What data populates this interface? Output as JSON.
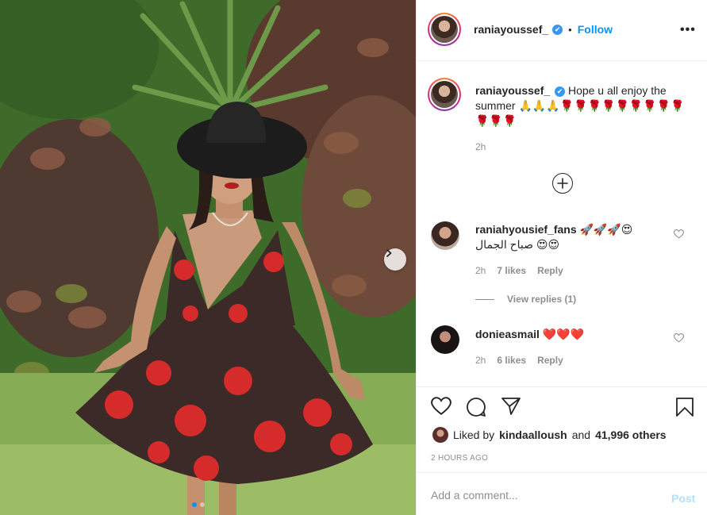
{
  "post": {
    "username": "raniayoussef_",
    "verified_icon": "✔",
    "follow_label": "Follow",
    "separator": "•",
    "more_icon": "•••"
  },
  "caption": {
    "username": "raniayoussef_",
    "text": "Hope u all enjoy the summer 🙏🙏🙏🌹🌹🌹🌹🌹🌹🌹🌹🌹🌹🌹🌹",
    "time": "2h"
  },
  "comments": [
    {
      "username": "raniahyousief_fans",
      "text": "🚀🚀🚀😍 صباح الجمال 😍😍",
      "time": "2h",
      "likes": "7 likes",
      "reply": "Reply",
      "view_replies": "View replies (1)"
    },
    {
      "username": "donieasmail",
      "text": "❤️❤️❤️",
      "time": "2h",
      "likes": "6 likes",
      "reply": "Reply"
    }
  ],
  "likes_summary": {
    "prefix": "Liked by",
    "user": "kindaalloush",
    "conjunction": "and",
    "others": "41,996 others"
  },
  "time_ago": "2 HOURS AGO",
  "add_comment": {
    "placeholder": "Add a comment...",
    "post_label": "Post"
  },
  "colors": {
    "accent": "#0095f6",
    "post_disabled": "#b2dffc",
    "muted": "#8e8e8e"
  }
}
